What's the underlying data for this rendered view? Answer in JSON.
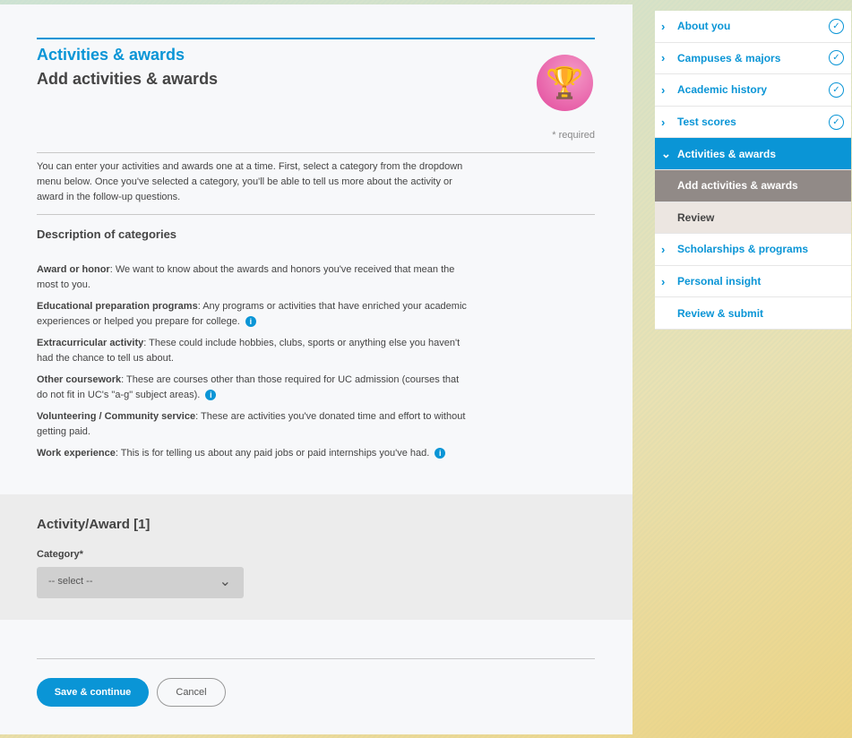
{
  "header": {
    "section": "Activities & awards",
    "title": "Add activities & awards",
    "required_note": "* required",
    "trophy_icon": "trophy-icon"
  },
  "intro": "You can enter your activities and awards one at a time. First, select a category from the dropdown menu below. Once you've selected a category, you'll be able to tell us more about the activity or award in the follow-up questions.",
  "categories_heading": "Description of categories",
  "categories": [
    {
      "term": "Award or honor",
      "desc": ": We want to know about the awards and honors you've received that mean the most to you.",
      "info": false
    },
    {
      "term": "Educational preparation programs",
      "desc": ": Any programs or activities that have enriched your academic experiences or helped you prepare for college.",
      "info": true
    },
    {
      "term": "Extracurricular activity",
      "desc": ": These could include hobbies, clubs, sports or anything else you haven't had the chance to tell us about.",
      "info": false
    },
    {
      "term": "Other coursework",
      "desc": ": These are courses other than those required for UC admission (courses that do not fit in UC's \"a-g\" subject areas).",
      "info": true
    },
    {
      "term": "Volunteering / Community service",
      "desc": ": These are activities you've donated time and effort to without getting paid.",
      "info": false
    },
    {
      "term": "Work experience",
      "desc": ": This is for telling us about any paid jobs or paid internships you've had.",
      "info": true
    }
  ],
  "form": {
    "heading": "Activity/Award [1]",
    "category_label": "Category*",
    "category_value": "-- select --"
  },
  "buttons": {
    "save": "Save & continue",
    "cancel": "Cancel"
  },
  "sidebar": [
    {
      "label": "About you",
      "state": "complete"
    },
    {
      "label": "Campuses & majors",
      "state": "complete"
    },
    {
      "label": "Academic history",
      "state": "complete"
    },
    {
      "label": "Test scores",
      "state": "complete"
    },
    {
      "label": "Activities & awards",
      "state": "active"
    },
    {
      "label": "Add activities & awards",
      "state": "sub-current"
    },
    {
      "label": "Review",
      "state": "sub"
    },
    {
      "label": "Scholarships & programs",
      "state": "collapsed"
    },
    {
      "label": "Personal insight",
      "state": "collapsed"
    },
    {
      "label": "Review & submit",
      "state": "none"
    }
  ],
  "colors": {
    "accent": "#0a95d6",
    "sub_current": "#918a87",
    "sub": "#ece6e1"
  }
}
